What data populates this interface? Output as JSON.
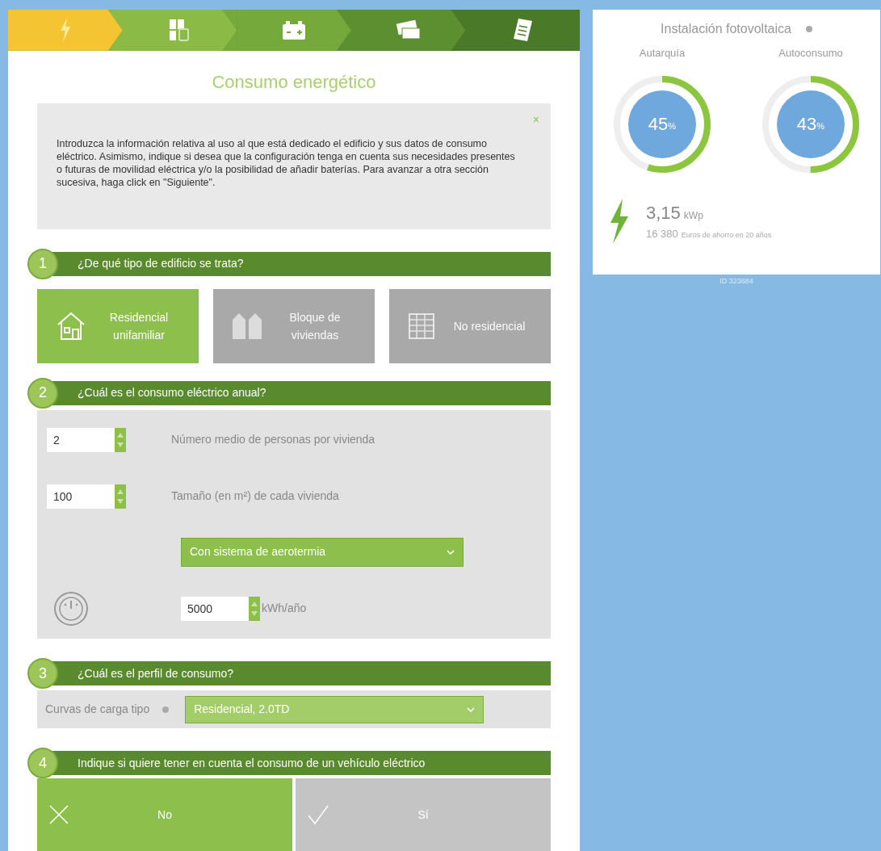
{
  "steps": [
    {
      "selected": true
    },
    {
      "selected": false
    },
    {
      "selected": false
    },
    {
      "selected": false
    },
    {
      "selected": false
    }
  ],
  "title": "Consumo energético",
  "info": {
    "text": "Introduzca la información relativa al uso al que está dedicado el edificio y sus datos de consumo eléctrico. Asimismo, indique si desea que la configuración tenga en cuenta sus necesidades presentes o futuras de movilidad eléctrica y/o la posibilidad de añadir baterías. Para avanzar a otra sección sucesiva, haga click en \"Siguiente\".",
    "close": "×"
  },
  "sections": [
    {
      "number": "1",
      "title": "¿De qué tipo de edificio se trata?"
    },
    {
      "number": "2",
      "title": "¿Cuál es el consumo eléctrico anual?"
    },
    {
      "number": "3",
      "title": "¿Cuál es el perfil de consumo?"
    },
    {
      "number": "4",
      "title": "Indique si quiere tener en cuenta el consumo de un vehículo eléctrico"
    }
  ],
  "building_types": [
    {
      "kind": "house",
      "label": "Residencial unifamiliar",
      "selected": true
    },
    {
      "kind": "block",
      "label": "Bloque de viviendas",
      "selected": false
    },
    {
      "kind": "office",
      "label": "No residencial",
      "selected": false
    }
  ],
  "consumption": {
    "persons": {
      "value": "2",
      "label": "Número medio de personas por vivienda"
    },
    "size": {
      "value": "100",
      "label": "Tamaño (en m²) de cada vivienda"
    },
    "heating": "Con sistema de aerotermia",
    "annual": {
      "value": "5000",
      "unit": "kWh/año"
    }
  },
  "profile": {
    "label": "Curvas de carga tipo",
    "value": "Residencial, 2.0TD"
  },
  "vehicle_options": [
    {
      "kind": "no",
      "label": "No",
      "selected": true
    },
    {
      "kind": "yes",
      "label": "Sí",
      "selected": false
    }
  ],
  "summary": {
    "title": "Instalación fotovoltaica",
    "gauges": [
      {
        "label": "Autarquía",
        "value": "45",
        "unit": "%"
      },
      {
        "label": "Autoconsumo",
        "value": "43",
        "unit": "%"
      }
    ],
    "power": "3,15",
    "power_unit": "kWp",
    "savings": "16 380",
    "savings_text": "Euros de ahorro en 20 años",
    "id": "ID 323684"
  }
}
